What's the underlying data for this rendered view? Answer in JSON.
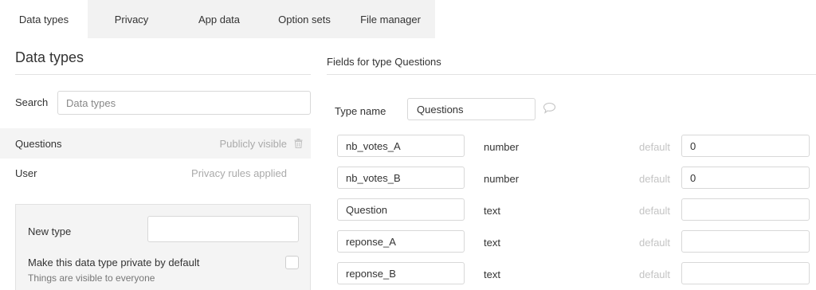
{
  "tabs": [
    {
      "label": "Data types",
      "active": true
    },
    {
      "label": "Privacy",
      "active": false
    },
    {
      "label": "App data",
      "active": false
    },
    {
      "label": "Option sets",
      "active": false
    },
    {
      "label": "File manager",
      "active": false
    }
  ],
  "left": {
    "title": "Data types",
    "search_label": "Search",
    "search_placeholder": "Data types",
    "types": [
      {
        "name": "Questions",
        "status": "Publicly visible",
        "selected": true,
        "icon": "trash-icon"
      },
      {
        "name": "User",
        "status": "Privacy rules applied",
        "selected": false
      }
    ],
    "new_type": {
      "label": "New type",
      "value": "",
      "private_label": "Make this data type private by default",
      "private_checked": false,
      "hint": "Things are visible to everyone"
    }
  },
  "right": {
    "title": "Fields for type Questions",
    "type_name_label": "Type name",
    "type_name_value": "Questions",
    "comment_icon": "comment-icon",
    "default_label": "default",
    "fields": [
      {
        "name": "nb_votes_A",
        "type": "number",
        "default": "0"
      },
      {
        "name": "nb_votes_B",
        "type": "number",
        "default": "0"
      },
      {
        "name": "Question",
        "type": "text",
        "default": ""
      },
      {
        "name": "reponse_A",
        "type": "text",
        "default": ""
      },
      {
        "name": "reponse_B",
        "type": "text",
        "default": ""
      }
    ]
  },
  "colors": {
    "tab_bar": "#f2f2f2",
    "selected_row": "#f4f4f4",
    "muted_text": "#aaaaaa",
    "border": "#d8d8d8"
  }
}
